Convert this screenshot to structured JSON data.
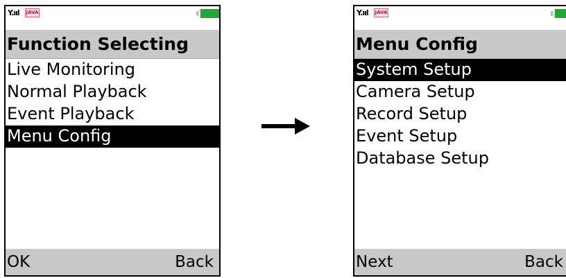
{
  "left_screen": {
    "status": {
      "signal_glyph": "Y.ııl",
      "java_badge": "JAVA",
      "battery": "battery-full"
    },
    "title": "Function Selecting",
    "menu": [
      {
        "label": "Live Monitoring",
        "selected": false
      },
      {
        "label": "Normal Playback",
        "selected": false
      },
      {
        "label": "Event Playback",
        "selected": false
      },
      {
        "label": "Menu Config",
        "selected": true
      }
    ],
    "softkeys": {
      "left": "OK",
      "right": "Back"
    }
  },
  "right_screen": {
    "status": {
      "signal_glyph": "Y.ııl",
      "java_badge": "JAVA",
      "battery": "battery-full"
    },
    "title": "Menu Config",
    "menu": [
      {
        "label": "System Setup",
        "selected": true
      },
      {
        "label": "Camera Setup",
        "selected": false
      },
      {
        "label": "Record Setup",
        "selected": false
      },
      {
        "label": "Event Setup",
        "selected": false
      },
      {
        "label": "Database Setup",
        "selected": false
      }
    ],
    "softkeys": {
      "left": "Next",
      "right": "Back"
    }
  },
  "transition": {
    "icon": "right-arrow-icon"
  },
  "colors": {
    "title_bar": "#c8c8c8",
    "selection": "#000000",
    "battery": "#22a83a",
    "java_badge": "#c8102e"
  }
}
